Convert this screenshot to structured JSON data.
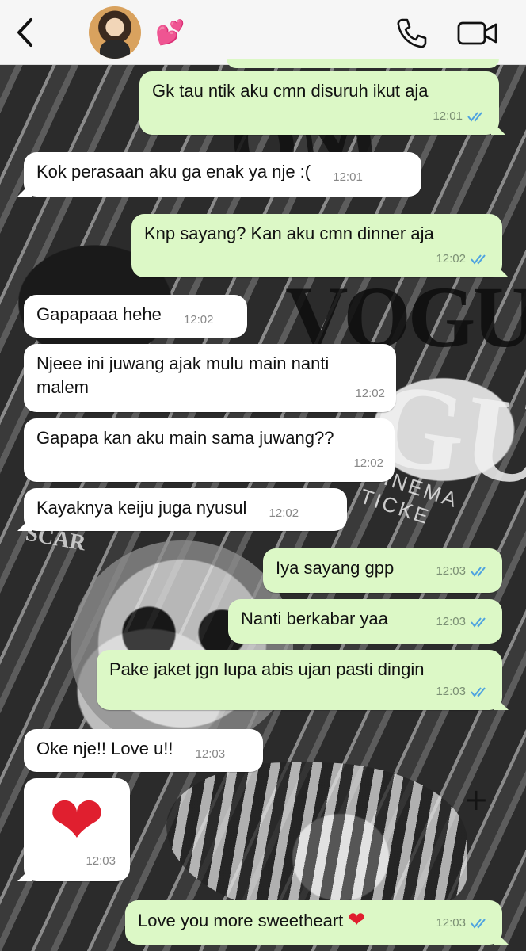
{
  "header": {
    "contact_name": "💕",
    "avatar_icon": "avatar",
    "back_icon": "chevron-left-icon",
    "call_icon": "phone-icon",
    "video_icon": "video-camera-icon"
  },
  "colors": {
    "outgoing_bubble": "#dcf8c6",
    "incoming_bubble": "#ffffff",
    "read_ticks": "#4fa3e0",
    "contact_emoji": "#e0489a"
  },
  "messages": [
    {
      "dir": "out",
      "text": "Gk tau ntik aku cmn disuruh ikut aja",
      "time": "12:01",
      "read": true
    },
    {
      "dir": "in",
      "text": "Kok perasaan aku ga enak ya nje :(",
      "time": "12:01"
    },
    {
      "dir": "out",
      "text": "Knp sayang? Kan aku cmn dinner aja",
      "time": "12:02",
      "read": true
    },
    {
      "dir": "in",
      "text": "Gapapaaa hehe",
      "time": "12:02"
    },
    {
      "dir": "in",
      "text": "Njeee ini juwang ajak mulu main nanti malem",
      "time": "12:02"
    },
    {
      "dir": "in",
      "text": "Gapapa kan aku main sama juwang??",
      "time": "12:02"
    },
    {
      "dir": "in",
      "text": "Kayaknya keiju juga nyusul",
      "time": "12:02"
    },
    {
      "dir": "out",
      "text": "Iya sayang gpp",
      "time": "12:03",
      "read": true
    },
    {
      "dir": "out",
      "text": "Nanti berkabar yaa",
      "time": "12:03",
      "read": true
    },
    {
      "dir": "out",
      "text": "Pake jaket jgn lupa abis ujan pasti dingin",
      "time": "12:03",
      "read": true
    },
    {
      "dir": "in",
      "text": "Oke nje!! Love u!!",
      "time": "12:03"
    },
    {
      "dir": "in",
      "text": "❤",
      "time": "12:03"
    },
    {
      "dir": "out",
      "text": "Love you more sweetheart",
      "emoji": "❤",
      "time": "12:03",
      "read": true
    }
  ],
  "wallpaper": {
    "texts": [
      "OM",
      "VOGU",
      "GU",
      "CINEMA TICKE",
      "SCAR",
      "+"
    ]
  }
}
